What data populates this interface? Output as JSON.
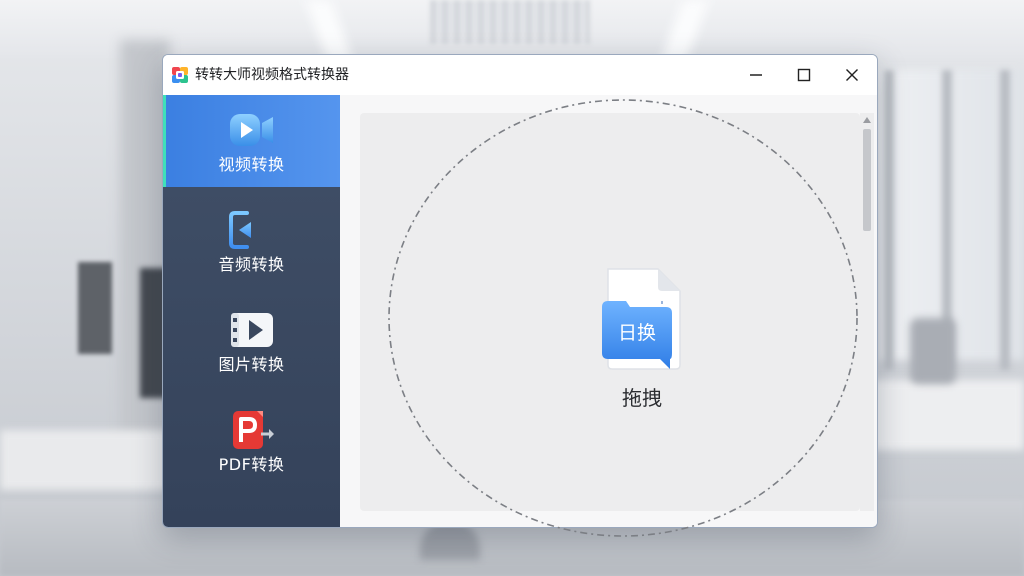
{
  "window": {
    "title": "转转大师视频格式转换器"
  },
  "sidebar": {
    "items": [
      {
        "label": "视频转换",
        "icon": "video-convert-icon",
        "active": true
      },
      {
        "label": "音频转换",
        "icon": "audio-convert-icon",
        "active": false
      },
      {
        "label": "图片转换",
        "icon": "image-convert-icon",
        "active": false
      },
      {
        "label": "PDF转换",
        "icon": "pdf-convert-icon",
        "active": false
      }
    ]
  },
  "dropzone": {
    "badge_text": "日换",
    "label": "拖拽"
  },
  "colors": {
    "sidebar_bg": "#3a475e",
    "active_bg": "#4a8be8",
    "active_indicator": "#3fe0b9",
    "accent_blue": "#3d86e6"
  }
}
